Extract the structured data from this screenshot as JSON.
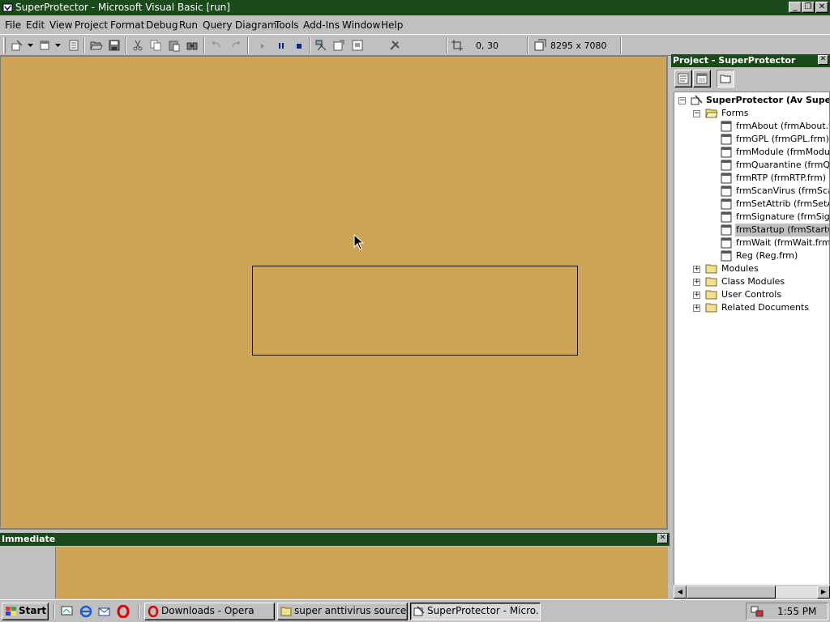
{
  "window": {
    "title": "SuperProtector - Microsoft Visual Basic [run]",
    "controls": {
      "minimize": "_",
      "maximize": "❐",
      "close": "✕"
    }
  },
  "menubar": {
    "items": [
      "File",
      "Edit",
      "View",
      "Project",
      "Format",
      "Debug",
      "Run",
      "Query",
      "Diagram",
      "Tools",
      "Add-Ins",
      "Window",
      "Help"
    ]
  },
  "toolbar": {
    "icons": [
      "add-project-icon",
      "add-form-icon",
      "menu-editor-icon",
      "open-project-icon",
      "save-project-icon",
      "cut-icon",
      "copy-icon",
      "paste-icon",
      "find-icon",
      "undo-icon",
      "redo-icon",
      "start-icon",
      "break-icon",
      "end-icon",
      "project-explorer-icon",
      "properties-window-icon",
      "form-layout-icon",
      "toolbox-icon"
    ],
    "position": "0, 30",
    "size": "8295 x 7080"
  },
  "design": {
    "background": "#cda454"
  },
  "immediate": {
    "title": "Immediate",
    "close": "✕"
  },
  "project": {
    "title": "Project - SuperProtector",
    "close": "✕",
    "root": "SuperProtector (Av Super P",
    "forms_folder": "Forms",
    "forms": [
      "frmAbout (frmAbout.frm",
      "frmGPL (frmGPL.frm)",
      "frmModule (frmModule.f",
      "frmQuarantine (frmQua",
      "frmRTP (frmRTP.frm)",
      "frmScanVirus (frmScanV",
      "frmSetAttrib (frmSetAtt",
      "frmSignature (frmSignat",
      "frmStartup (frmStartup",
      "frmWait (frmWait.frm)",
      "Reg (Reg.frm)"
    ],
    "selected_form": "frmStartup (frmStartup",
    "folders": [
      "Modules",
      "Class Modules",
      "User Controls",
      "Related Documents"
    ]
  },
  "taskbar": {
    "start": "Start",
    "quicklaunch": [
      "show-desktop-icon",
      "internet-explorer-icon",
      "outlook-icon",
      "opera-icon"
    ],
    "tasks": [
      {
        "label": "Downloads - Opera",
        "icon": "opera-icon",
        "active": false
      },
      {
        "label": "super anttivirus source...",
        "icon": "folder-icon",
        "active": false
      },
      {
        "label": "SuperProtector - Micro...",
        "icon": "vb-icon",
        "active": true
      }
    ],
    "clock": "1:55 PM"
  }
}
